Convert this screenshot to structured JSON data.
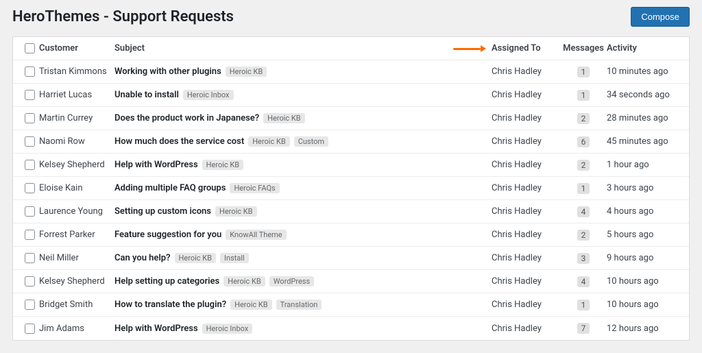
{
  "header": {
    "title": "HeroThemes - Support Requests",
    "compose_label": "Compose"
  },
  "columns": {
    "customer": "Customer",
    "subject": "Subject",
    "assigned": "Assigned To",
    "messages": "Messages",
    "activity": "Activity"
  },
  "tickets": [
    {
      "customer": "Tristan Kimmons",
      "subject": "Working with other plugins",
      "tags": [
        "Heroic KB"
      ],
      "assigned": "Chris Hadley",
      "messages": "1",
      "activity": "10 minutes ago"
    },
    {
      "customer": "Harriet Lucas",
      "subject": "Unable to install",
      "tags": [
        "Heroic Inbox"
      ],
      "assigned": "Chris Hadley",
      "messages": "1",
      "activity": "34 seconds ago"
    },
    {
      "customer": "Martin Currey",
      "subject": "Does the product work in Japanese?",
      "tags": [
        "Heroic KB"
      ],
      "assigned": "Chris Hadley",
      "messages": "2",
      "activity": "28 minutes ago"
    },
    {
      "customer": "Naomi Row",
      "subject": "How much does the service cost",
      "tags": [
        "Heroic KB",
        "Custom"
      ],
      "assigned": "Chris Hadley",
      "messages": "6",
      "activity": "45 minutes ago"
    },
    {
      "customer": "Kelsey Shepherd",
      "subject": "Help with WordPress",
      "tags": [
        "Heroic KB"
      ],
      "assigned": "Chris Hadley",
      "messages": "2",
      "activity": "1 hour ago"
    },
    {
      "customer": "Eloise Kain",
      "subject": "Adding multiple FAQ groups",
      "tags": [
        "Heroic FAQs"
      ],
      "assigned": "Chris Hadley",
      "messages": "1",
      "activity": "3 hours ago"
    },
    {
      "customer": "Laurence Young",
      "subject": "Setting up custom icons",
      "tags": [
        "Heroic KB"
      ],
      "assigned": "Chris Hadley",
      "messages": "4",
      "activity": "4 hours ago"
    },
    {
      "customer": "Forrest Parker",
      "subject": "Feature suggestion for you",
      "tags": [
        "KnowAll Theme"
      ],
      "assigned": "Chris Hadley",
      "messages": "2",
      "activity": "5 hours ago"
    },
    {
      "customer": "Neil Miller",
      "subject": "Can you help?",
      "tags": [
        "Heroic KB",
        "Install"
      ],
      "assigned": "Chris Hadley",
      "messages": "3",
      "activity": "9 hours ago"
    },
    {
      "customer": "Kelsey Shepherd",
      "subject": "Help setting up categories",
      "tags": [
        "Heroic KB",
        "WordPress"
      ],
      "assigned": "Chris Hadley",
      "messages": "4",
      "activity": "10 hours ago"
    },
    {
      "customer": "Bridget Smith",
      "subject": "How to translate the plugin?",
      "tags": [
        "Heroic KB",
        "Translation"
      ],
      "assigned": "Chris Hadley",
      "messages": "1",
      "activity": "10 hours ago"
    },
    {
      "customer": "Jim Adams",
      "subject": "Help with WordPress",
      "tags": [
        "Heroic Inbox"
      ],
      "assigned": "Chris Hadley",
      "messages": "7",
      "activity": "12 hours ago"
    }
  ]
}
